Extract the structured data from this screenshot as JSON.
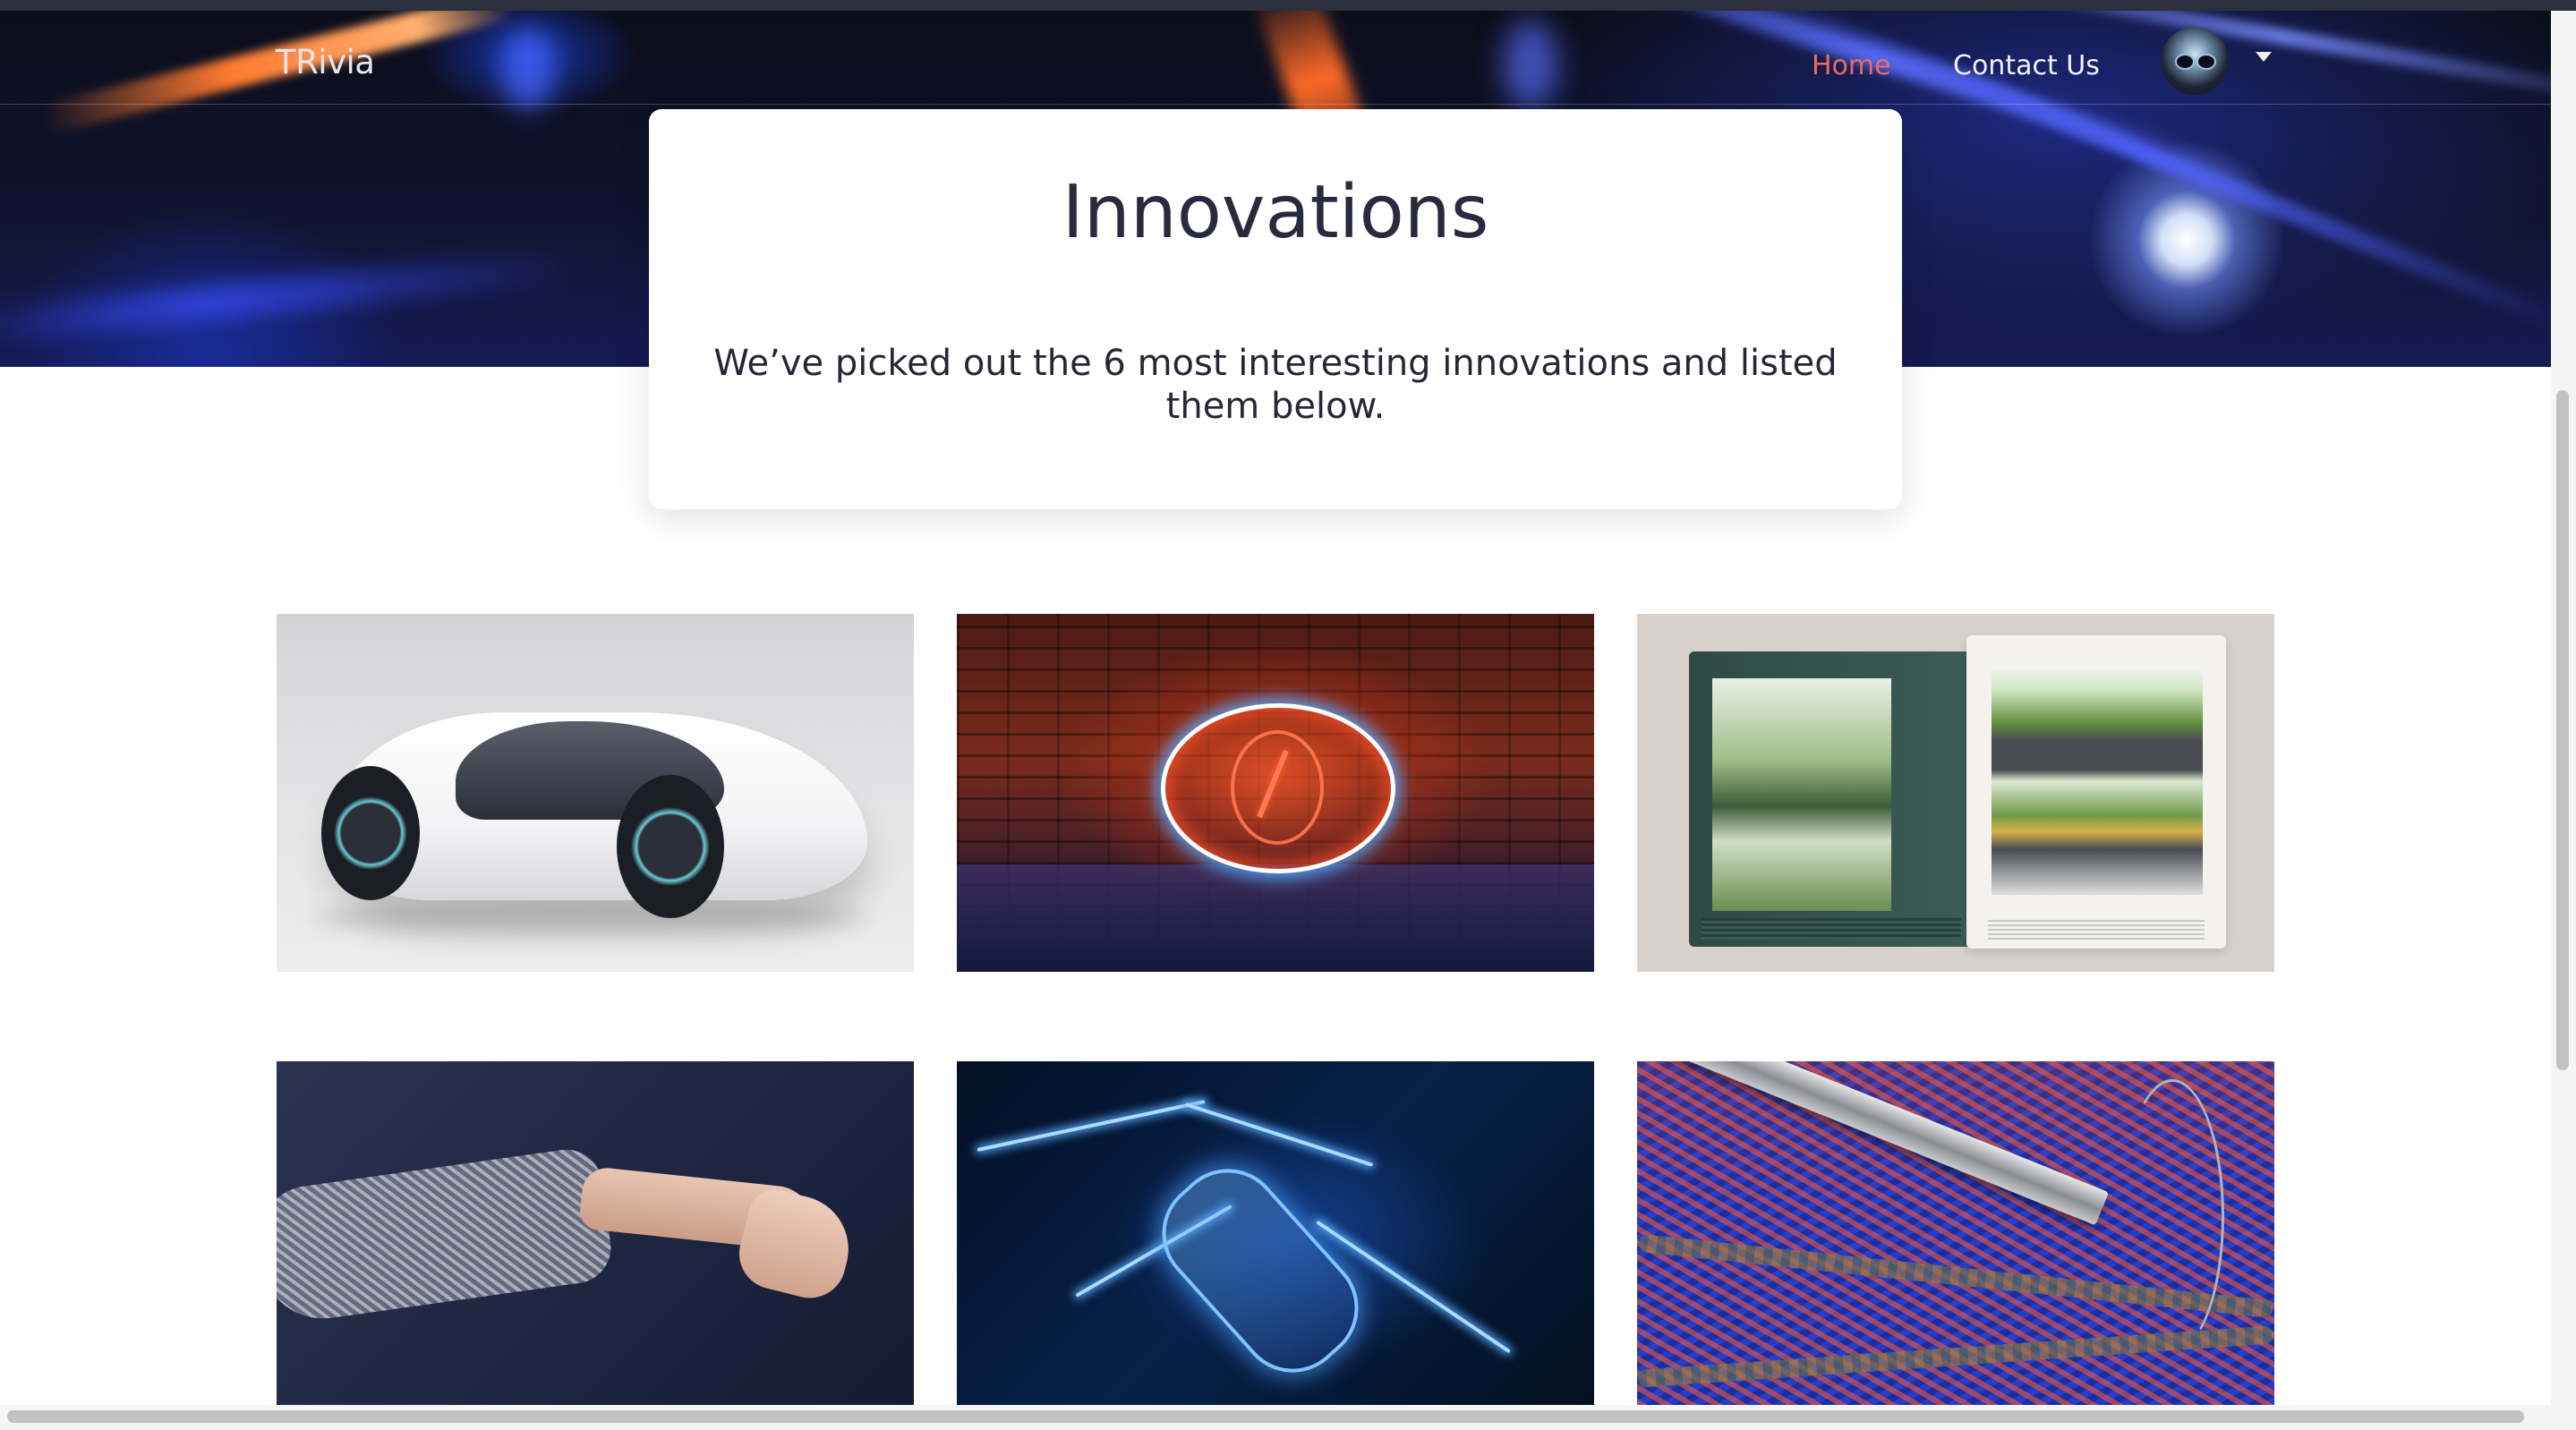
{
  "navbar": {
    "brand": "TRivia",
    "links": [
      {
        "label": "Home",
        "active": true,
        "color": "#f06a5e"
      },
      {
        "label": "Contact Us",
        "active": false
      }
    ],
    "profile_icon": "avatar-icon",
    "dropdown_icon": "caret-down-icon"
  },
  "hero": {
    "title": "Innovations",
    "subtitle": "We’ve picked out the 6 most interesting innovations and listed them below."
  },
  "innovations": [
    {
      "image": "concept-car-image"
    },
    {
      "image": "neon-lightning-image"
    },
    {
      "image": "indoor-garden-cabinets-image"
    },
    {
      "image": "textile-sleeve-arm-image"
    },
    {
      "image": "electric-battery-image"
    },
    {
      "image": "woven-fabric-tweezers-image"
    }
  ],
  "colors": {
    "accent": "#f06a5e",
    "nav_text": "#f2f2f4",
    "heading": "#2a2a3e"
  }
}
